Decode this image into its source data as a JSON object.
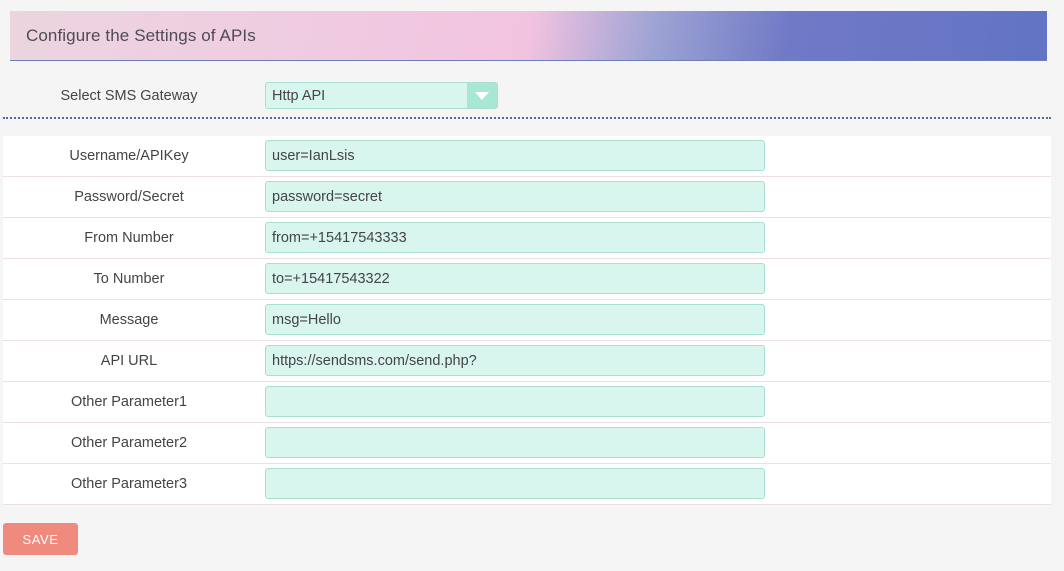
{
  "header": {
    "title": "Configure the Settings of APIs"
  },
  "gateway": {
    "label": "Select SMS Gateway",
    "selected": "Http API"
  },
  "fields": [
    {
      "label": "Username/APIKey",
      "value": "user=IanLsis"
    },
    {
      "label": "Password/Secret",
      "value": "password=secret"
    },
    {
      "label": "From Number",
      "value": "from=+15417543333"
    },
    {
      "label": "To Number",
      "value": "to=+15417543322"
    },
    {
      "label": "Message",
      "value": "msg=Hello"
    },
    {
      "label": "API URL",
      "value": "https://sendsms.com/send.php?"
    },
    {
      "label": "Other Parameter1",
      "value": ""
    },
    {
      "label": "Other Parameter2",
      "value": ""
    },
    {
      "label": "Other Parameter3",
      "value": ""
    }
  ],
  "actions": {
    "save_label": "SAVE"
  },
  "colors": {
    "field_bg": "#d9f6ee",
    "save_button": "#f08a7e",
    "separator": "#5667a8"
  }
}
